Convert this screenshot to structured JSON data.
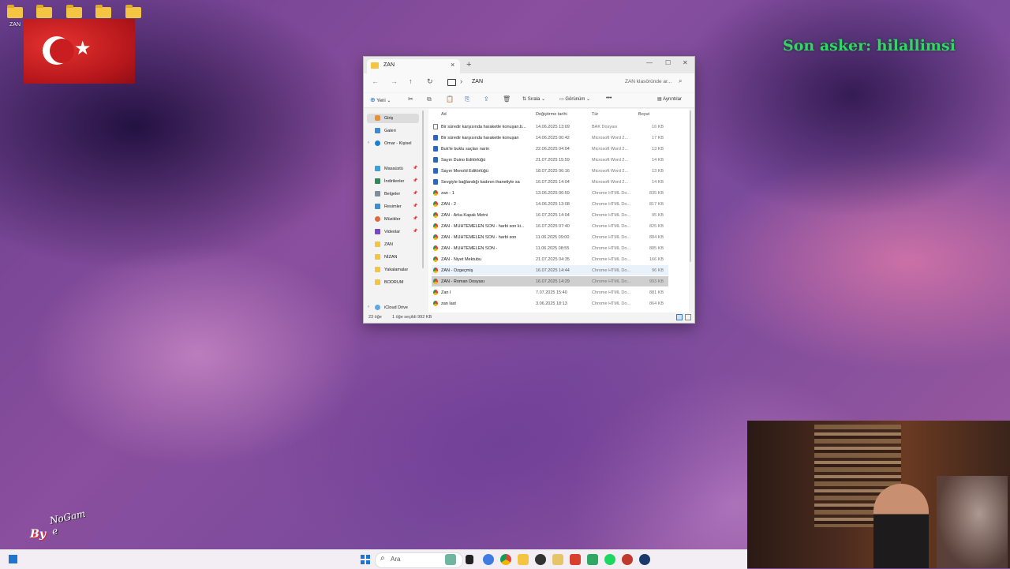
{
  "desktop": {
    "icon_label": "ZAN",
    "overlay_text": "Son asker: hilallimsi",
    "watermark_line1": "By",
    "watermark_line2": "NoGam e"
  },
  "window": {
    "tab_title": "ZAN",
    "breadcrumb": "ZAN",
    "search_placeholder": "ZAN klasöründe ar..."
  },
  "toolbar": {
    "new": "Yeni",
    "sort": "Sırala",
    "view": "Görünüm",
    "more": "•••",
    "details": "Ayrıntılar"
  },
  "sidebar": {
    "items": [
      {
        "label": "Giriş"
      },
      {
        "label": "Galeri"
      },
      {
        "label": "Omar - Kişisel"
      },
      {
        "label": "Masaüstü"
      },
      {
        "label": "İndirilenler"
      },
      {
        "label": "Belgeler"
      },
      {
        "label": "Resimler"
      },
      {
        "label": "Müzikler"
      },
      {
        "label": "Videolar"
      },
      {
        "label": "ZAN"
      },
      {
        "label": "NİZAN"
      },
      {
        "label": "Yakalamalar"
      },
      {
        "label": "BODRUM"
      },
      {
        "label": "iCloud Drive"
      }
    ]
  },
  "columns": {
    "name": "Ad",
    "date": "Değiştirme tarihi",
    "type": "Tür",
    "size": "Boyut"
  },
  "files": [
    {
      "name": "Bir süredir karşısında haraketle konuşan.b...",
      "date": "14.06.2025 13:09",
      "type": "BAK Dosyası",
      "size": "16 KB"
    },
    {
      "name": "Bir süredir karşısında haraketle konuşan",
      "date": "14.06.2025 00:42",
      "type": "Microsoft Word 2...",
      "size": "17 KB"
    },
    {
      "name": "Buk'le buklu saçları narin",
      "date": "22.06.2025 04:04",
      "type": "Microsoft Word 2...",
      "size": "13 KB"
    },
    {
      "name": "Sayın Duino Editörlüğü",
      "date": "21.07.2025 15:59",
      "type": "Microsoft Word 2...",
      "size": "14 KB"
    },
    {
      "name": "Sayın Monold Editörlüğü",
      "date": "18.07.2025 06:16",
      "type": "Microsoft Word 2...",
      "size": "13 KB"
    },
    {
      "name": "Sevgiyle bağlandığı kadının ihanetiyle sa",
      "date": "16.07.2025 14:04",
      "type": "Microsoft Word 2...",
      "size": "14 KB"
    },
    {
      "name": "zan - 1",
      "date": "13.06.2025 06:59",
      "type": "Chrome HTML Do...",
      "size": "835 KB"
    },
    {
      "name": "ZAN - 2",
      "date": "14.06.2025 13:08",
      "type": "Chrome HTML Do...",
      "size": "817 KB"
    },
    {
      "name": "ZAN - Arka Kapak Metni",
      "date": "16.07.2025 14:04",
      "type": "Chrome HTML Do...",
      "size": "95 KB"
    },
    {
      "name": "ZAN - MUHTEMELEN SON - harbi son ki...",
      "date": "16.07.2025 07:40",
      "type": "Chrome HTML Do...",
      "size": "825 KB"
    },
    {
      "name": "ZAN - MUHTEMELEN SON - harbi son",
      "date": "11.06.2025 09:00",
      "type": "Chrome HTML Do...",
      "size": "884 KB"
    },
    {
      "name": "ZAN - MUHTEMELEN SON -",
      "date": "11.06.2025 08:55",
      "type": "Chrome HTML Do...",
      "size": "885 KB"
    },
    {
      "name": "ZAN - Niyet Mektubu",
      "date": "21.07.2025 04:35",
      "type": "Chrome HTML Do...",
      "size": "166 KB"
    },
    {
      "name": "ZAN - Özgeçmiş",
      "date": "16.07.2025 14:44",
      "type": "Chrome HTML Do...",
      "size": "96 KB"
    },
    {
      "name": "ZAN - Roman Dosyası",
      "date": "16.07.2025 14:29",
      "type": "Chrome HTML Do...",
      "size": "993 KB"
    },
    {
      "name": "Zan I",
      "date": "7.07.2025 15:40",
      "type": "Chrome HTML Do...",
      "size": "881 KB"
    },
    {
      "name": "zan last",
      "date": "3.06.2025 18:13",
      "type": "Chrome HTML Do...",
      "size": "864 KB"
    }
  ],
  "status": {
    "count": "23 öğe",
    "selected": "1 öğe seçildi  992 KB"
  },
  "taskbar": {
    "search_label": "Ara"
  },
  "colors": {
    "accent": "#1f74d0",
    "overlay_green": "#37d26c",
    "folder": "#f4c542"
  }
}
